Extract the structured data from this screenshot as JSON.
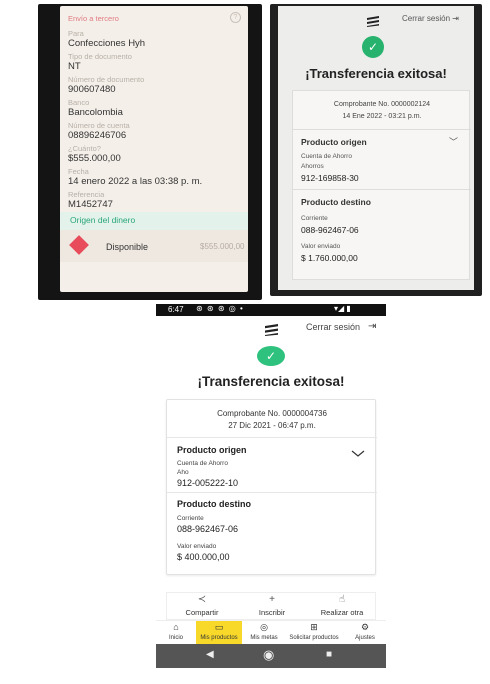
{
  "photo1": {
    "header": "Envío a tercero",
    "fields": [
      {
        "label": "Para",
        "value": "Confecciones Hyh"
      },
      {
        "label": "Tipo de documento",
        "value": "NT"
      },
      {
        "label": "Número de documento",
        "value": "900607480"
      },
      {
        "label": "Banco",
        "value": "Bancolombia"
      },
      {
        "label": "Número de cuenta",
        "value": "08896246706"
      },
      {
        "label": "¿Cuánto?",
        "value": "$555.000,00"
      },
      {
        "label": "Fecha",
        "value": "14 enero 2022 a las 03:38 p. m."
      },
      {
        "label": "Referencia",
        "value": "M1452747"
      }
    ],
    "origin_title": "Origen del dinero",
    "product_label": "Disponible",
    "product_amount": "$555.000,00"
  },
  "photo2": {
    "logout": "Cerrar sesión",
    "title": "¡Transferencia exitosa!",
    "voucher": "Comprobante No. 0000002124",
    "date": "14 Ene 2022 - 03:21 p.m.",
    "origin": {
      "title": "Producto origen",
      "type": "Cuenta de Ahorro",
      "subtype": "Ahorros",
      "account": "912-169858-30"
    },
    "destination": {
      "title": "Producto destino",
      "type": "Corriente",
      "account": "088-962467-06"
    },
    "amount_label": "Valor enviado",
    "amount": "$ 1.760.000,00"
  },
  "screen": {
    "status": {
      "time": "6:47",
      "icons": "⊛ ⊛ ⊛ ◎ •",
      "right": "▾◢ ▮"
    },
    "logout": "Cerrar sesión",
    "title": "¡Transferencia exitosa!",
    "voucher": "Comprobante No. 0000004736",
    "date": "27 Dic 2021 - 06:47 p.m.",
    "origin": {
      "title": "Producto origen",
      "type": "Cuenta de Ahorro",
      "subtype": "Aho",
      "account": "912-005222-10"
    },
    "destination": {
      "title": "Producto destino",
      "type": "Corriente",
      "account": "088-962467-06"
    },
    "amount_label": "Valor enviado",
    "amount": "$ 400.000,00",
    "actions": [
      {
        "icon": "share-icon",
        "label": "Compartir"
      },
      {
        "icon": "plus-icon",
        "label": "Inscribir"
      },
      {
        "icon": "hand-icon",
        "label": "Realizar otra"
      }
    ],
    "nav": [
      {
        "icon": "home-icon",
        "label": "Inicio"
      },
      {
        "icon": "wallet-icon",
        "label": "Mis productos"
      },
      {
        "icon": "target-icon",
        "label": "Mis metas"
      },
      {
        "icon": "cart-icon",
        "label": "Solicitar productos"
      },
      {
        "icon": "gear-icon",
        "label": "Ajustes"
      }
    ],
    "accent": "#2ec27e",
    "nav_highlight": "#f8d92a"
  }
}
